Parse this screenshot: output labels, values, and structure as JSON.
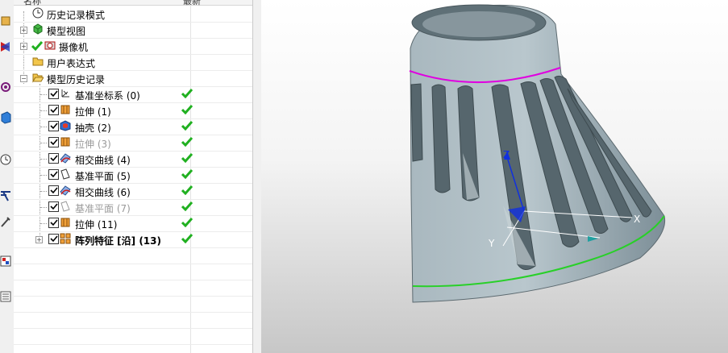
{
  "navigator": {
    "header": {
      "name_col": "名称",
      "latest_col": "最新"
    },
    "rows": [
      {
        "label": "历史记录模式",
        "icon": "clock-icon"
      },
      {
        "label": "模型视图",
        "icon": "model-view-icon"
      },
      {
        "label": "摄像机",
        "icon": "camera-icon"
      },
      {
        "label": "用户表达式",
        "icon": "folder-icon"
      },
      {
        "label": "模型历史记录",
        "icon": "folder-open-icon"
      },
      {
        "label": "基准坐标系 (0)",
        "icon": "datum-csys-icon",
        "ok": true
      },
      {
        "label": "拉伸 (1)",
        "icon": "extrude-icon",
        "ok": true
      },
      {
        "label": "抽壳 (2)",
        "icon": "shell-icon",
        "ok": true
      },
      {
        "label": "拉伸 (3)",
        "icon": "extrude-icon",
        "ok": true,
        "dim": true
      },
      {
        "label": "相交曲线 (4)",
        "icon": "intersection-curve-icon",
        "ok": true
      },
      {
        "label": "基准平面 (5)",
        "icon": "datum-plane-icon",
        "ok": true
      },
      {
        "label": "相交曲线 (6)",
        "icon": "intersection-curve-icon",
        "ok": true
      },
      {
        "label": "基准平面 (7)",
        "icon": "datum-plane-icon",
        "ok": true,
        "dim": true
      },
      {
        "label": "拉伸 (11)",
        "icon": "extrude-icon",
        "ok": true
      },
      {
        "label": "阵列特征 [沿] (13)",
        "icon": "pattern-feature-icon",
        "ok": true,
        "bold": true
      }
    ]
  },
  "viewport": {
    "axis_labels": {
      "z": "Z",
      "y": "Y",
      "x": "X"
    },
    "colors": {
      "model": "#9fb0b8",
      "top_edge": "#e000e0",
      "bottom_edge": "#28d028",
      "axis_blue": "#1030e0"
    }
  }
}
